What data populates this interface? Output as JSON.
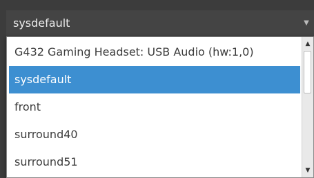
{
  "combo": {
    "value": "sysdefault",
    "arrow_icon": "chevron-down-icon"
  },
  "dropdown": {
    "items": [
      {
        "label": "G432 Gaming Headset: USB Audio (hw:1,0)"
      },
      {
        "label": "sysdefault"
      },
      {
        "label": "front"
      },
      {
        "label": "surround40"
      },
      {
        "label": "surround51"
      }
    ],
    "selected_index": 1
  },
  "scrollbar": {
    "up_icon": "arrow-up-icon",
    "down_icon": "arrow-down-icon"
  },
  "colors": {
    "background": "#3c3c3c",
    "combo_background": "#444444",
    "selection": "#3d8fd1",
    "list_background": "#ffffff",
    "list_text": "#3c3c3c"
  }
}
